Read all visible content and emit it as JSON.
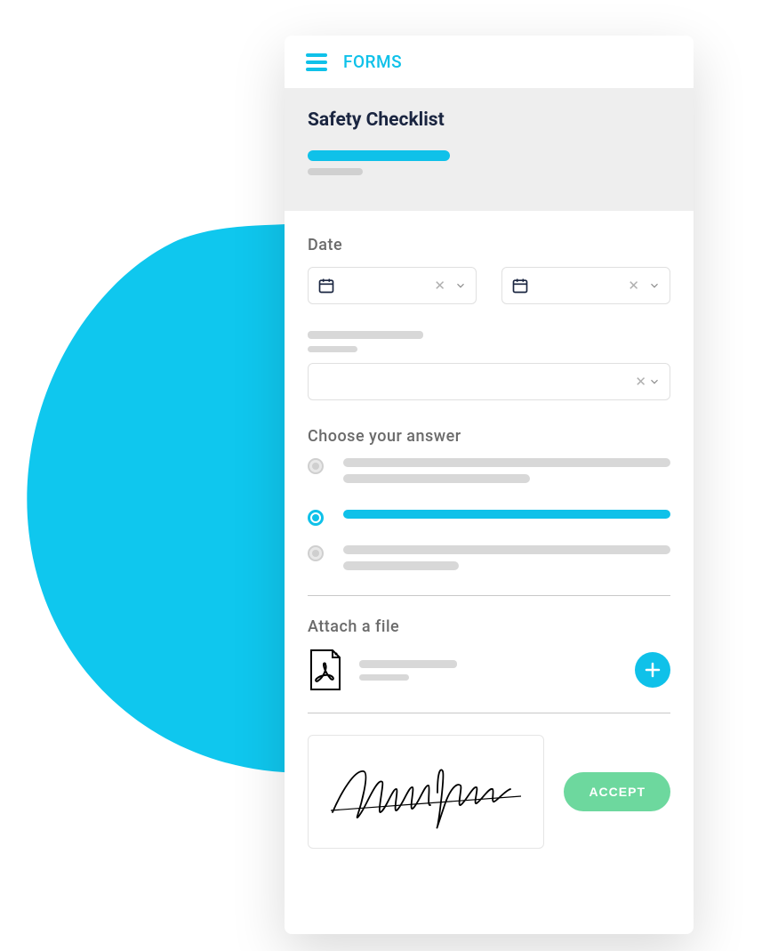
{
  "header": {
    "title": "FORMS"
  },
  "form": {
    "title": "Safety Checklist"
  },
  "fields": {
    "date_label": "Date",
    "answer_label": "Choose your answer",
    "attach_label": "Attach a file"
  },
  "radio": {
    "selected_index": 1
  },
  "buttons": {
    "accept": "ACCEPT"
  },
  "colors": {
    "accent": "#0FC1E9",
    "success": "#6DD89E"
  }
}
